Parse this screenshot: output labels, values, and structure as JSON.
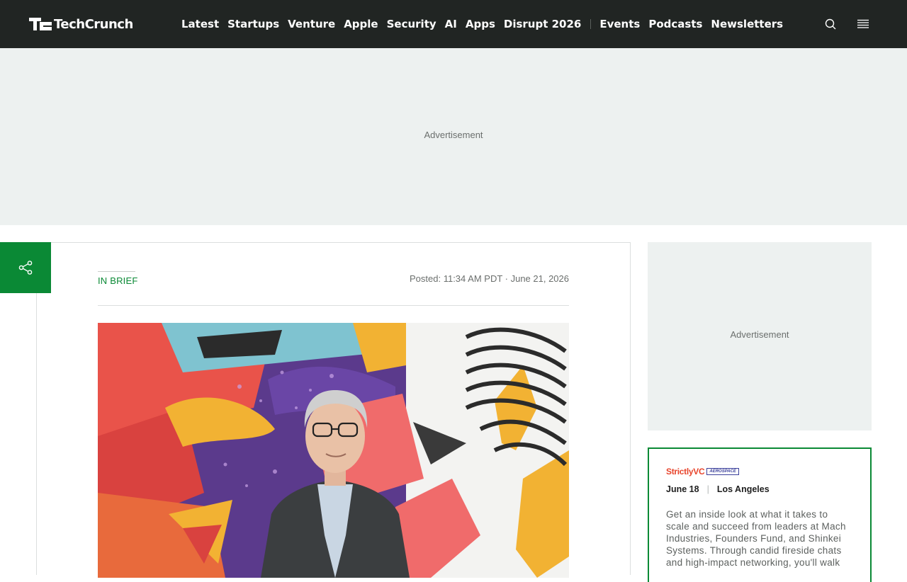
{
  "header": {
    "logo_text": "TechCrunch",
    "nav": [
      "Latest",
      "Startups",
      "Venture",
      "Apple",
      "Security",
      "AI",
      "Apps",
      "Disrupt 2026"
    ],
    "nav_secondary": [
      "Events",
      "Podcasts",
      "Newsletters"
    ],
    "icons": {
      "search": "search-icon",
      "menu": "hamburger-menu-icon"
    }
  },
  "ads": {
    "banner_label": "Advertisement",
    "sidebar_label": "Advertisement"
  },
  "share": {
    "icon": "share-icon"
  },
  "article": {
    "kicker": "IN BRIEF",
    "posted": "Posted: 11:34 AM PDT · June 21, 2026"
  },
  "event": {
    "brand": "StrictlyVC",
    "partner": "AEROSPACE",
    "date": "June 18",
    "location": "Los Angeles",
    "description": "Get an inside look at what it takes to scale and succeed from leaders at Mach Industries, Founders Fund, and Shinkei Systems. Through candid fireside chats and high-impact networking, you'll walk"
  },
  "colors": {
    "header_bg": "#212523",
    "accent_green": "#0a8935",
    "ad_bg": "#edf1f0",
    "event_brand": "#e8452c"
  }
}
